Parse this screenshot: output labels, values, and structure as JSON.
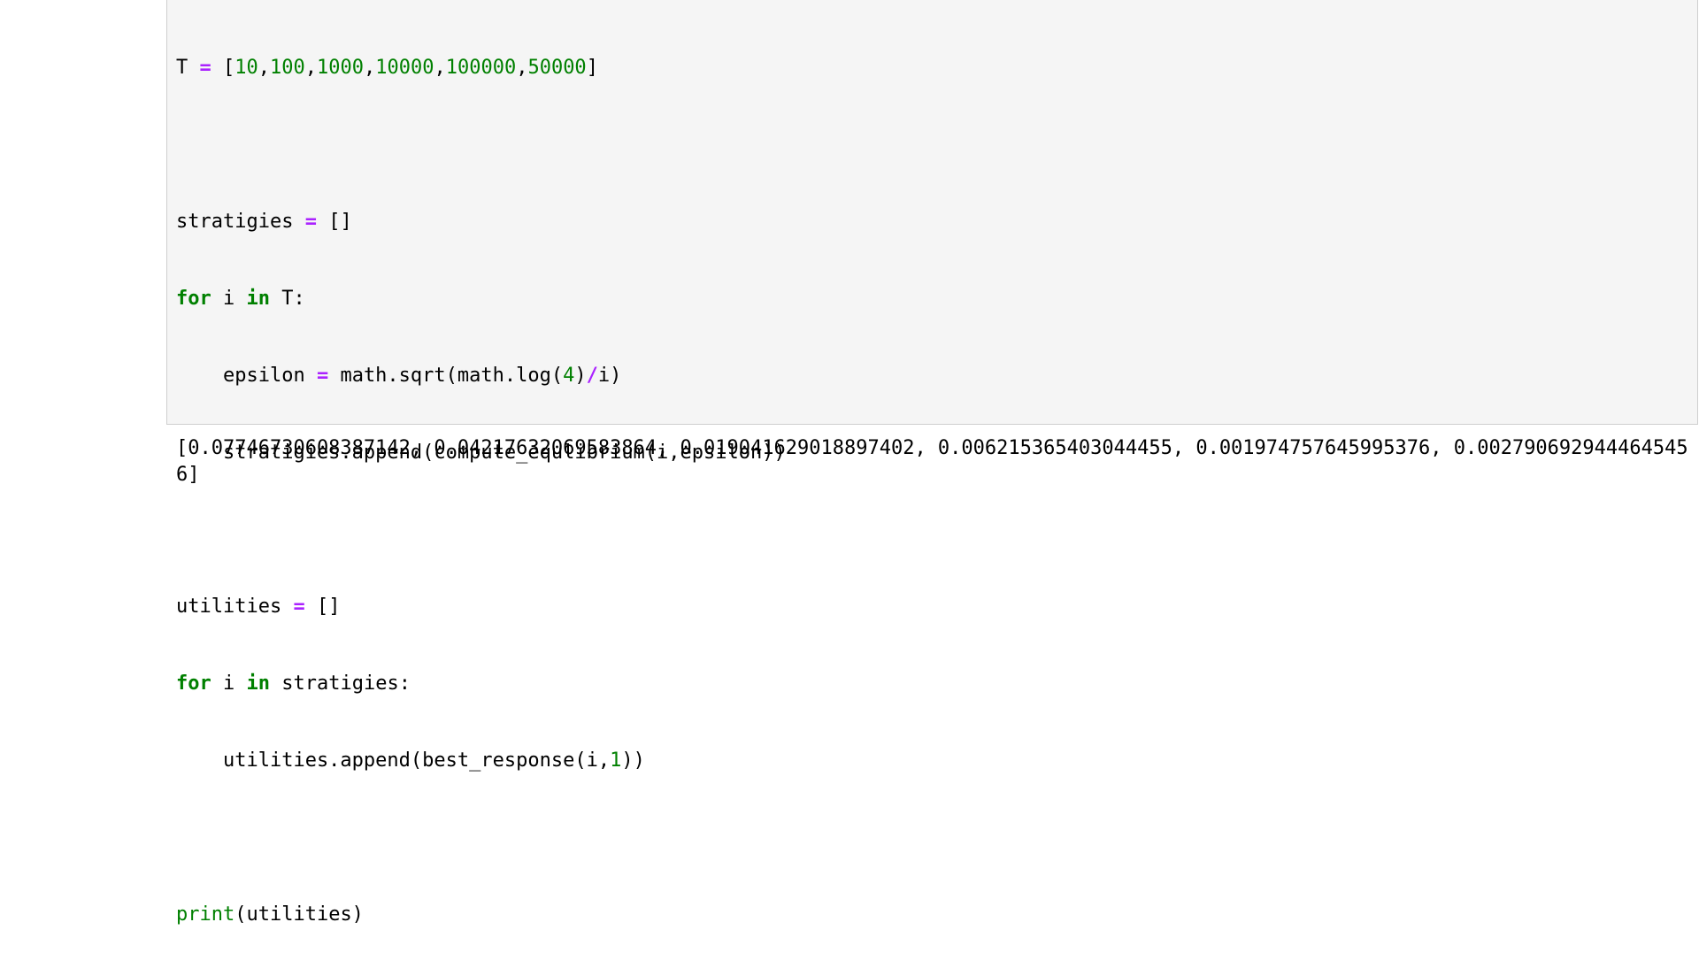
{
  "cell": {
    "code": {
      "line1": {
        "var": "T",
        "eq": "=",
        "open": "[",
        "nums": [
          "10",
          "100",
          "1000",
          "10000",
          "100000",
          "50000"
        ],
        "close": "]"
      },
      "line3": {
        "text": "stratigies ",
        "eq": "=",
        "rest": " []"
      },
      "line4": {
        "kw_for": "for",
        "mid": " i ",
        "kw_in": "in",
        "rest": " T:"
      },
      "line5": {
        "pre": "    epsilon ",
        "eq": "=",
        "call": " math.sqrt(math.log(",
        "num": "4",
        "close": ")",
        "div": "/",
        "tail": "i)"
      },
      "line6": {
        "text": "    stratigies.append(compute_equlibrium(i,epsilon))"
      },
      "line8": {
        "text": "utilities ",
        "eq": "=",
        "rest": " []"
      },
      "line9": {
        "kw_for": "for",
        "mid": " i ",
        "kw_in": "in",
        "rest": " stratigies:"
      },
      "line10": {
        "pre": "    utilities.append(best_response(i,",
        "num": "1",
        "tail": "))"
      },
      "line12": {
        "builtin": "print",
        "rest": "(utilities)"
      }
    },
    "output": "[0.07746730608387142, 0.04217632069583864, 0.019041629018897402, 0.006215365403044455, 0.001974757645995376, 0.0027906929444645456]"
  }
}
